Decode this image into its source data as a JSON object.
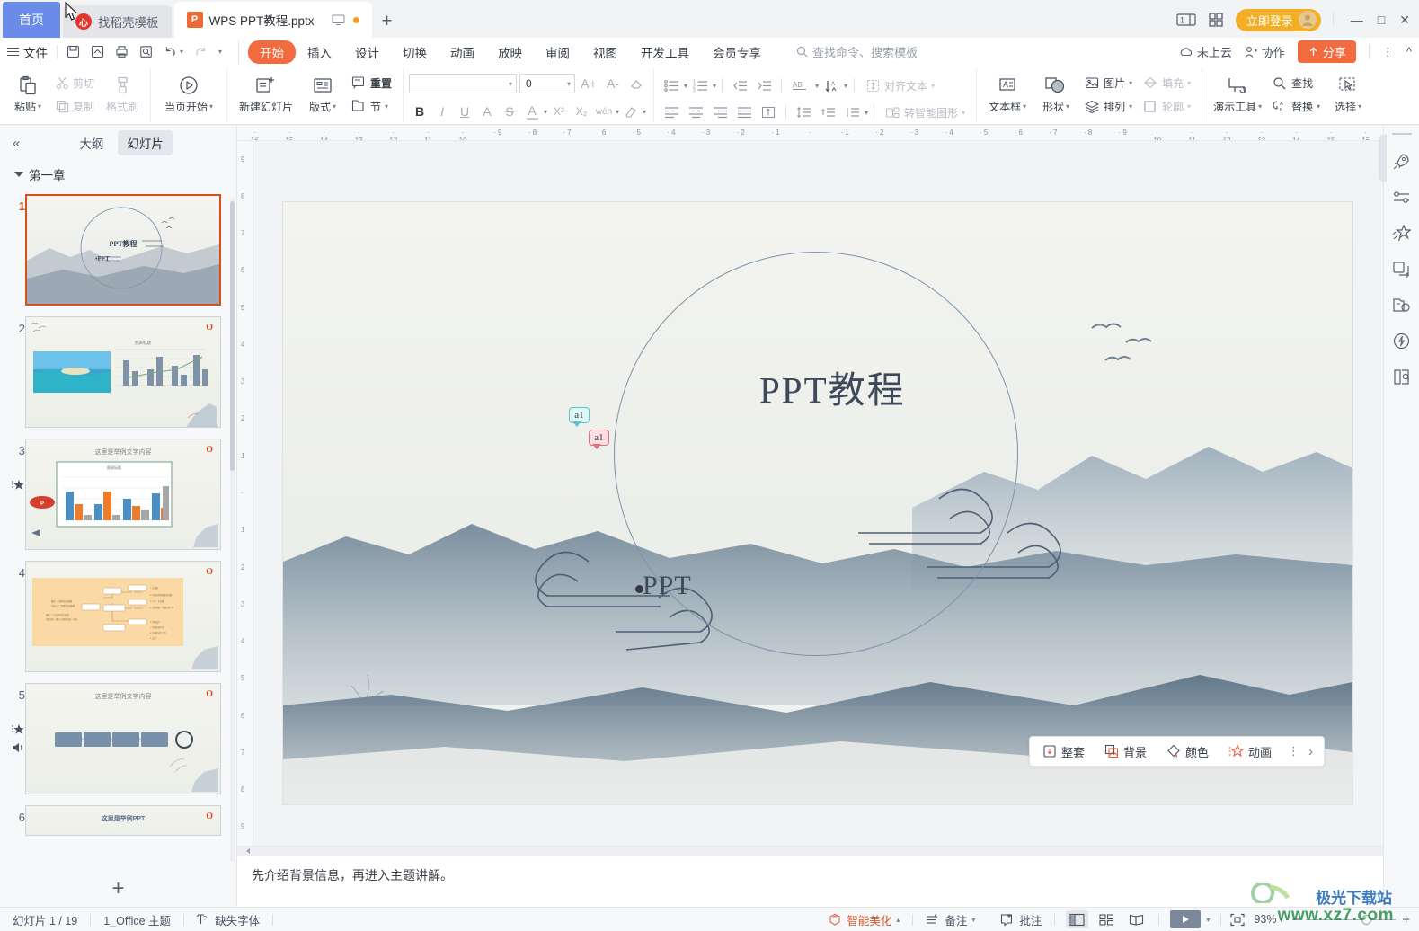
{
  "titlebar": {
    "home_tab": "首页",
    "tabs": [
      {
        "label": "找稻壳模板",
        "icon": "daoke-icon",
        "active": false
      },
      {
        "label": "WPS PPT教程.pptx",
        "icon": "wps-ppt-icon",
        "active": true
      }
    ],
    "new_tab": "+",
    "login_label": "立即登录",
    "minimize": "—",
    "maximize": "□",
    "close": "✕"
  },
  "menubar": {
    "file_label": "文件",
    "quick_access": [
      "save-icon",
      "save-as-icon",
      "print-icon",
      "print-preview-icon",
      "undo-icon",
      "redo-icon",
      "customize-icon"
    ],
    "tabs": [
      {
        "label": "开始",
        "selected": true
      },
      {
        "label": "插入",
        "selected": false
      },
      {
        "label": "设计",
        "selected": false
      },
      {
        "label": "切换",
        "selected": false
      },
      {
        "label": "动画",
        "selected": false
      },
      {
        "label": "放映",
        "selected": false
      },
      {
        "label": "审阅",
        "selected": false
      },
      {
        "label": "视图",
        "selected": false
      },
      {
        "label": "开发工具",
        "selected": false
      },
      {
        "label": "会员专享",
        "selected": false
      }
    ],
    "search_placeholder": "查找命令、搜索模板",
    "cloud_label": "未上云",
    "collab_label": "协作",
    "share_label": "分享",
    "more": "⋮"
  },
  "ribbon": {
    "clipboard": {
      "paste": "粘贴",
      "cut": "剪切",
      "copy": "复制",
      "format_painter": "格式刷"
    },
    "present": {
      "start_here": "当页开始"
    },
    "slides": {
      "new_slide": "新建幻灯片",
      "layout": "版式",
      "reset": "重置",
      "section": "节"
    },
    "font": {
      "family_value": "",
      "size_value": "0",
      "grow": "A+",
      "shrink": "A-",
      "clear_format": "clear-format-icon",
      "bold": "B",
      "italic": "I",
      "underline": "U",
      "char_border": "A",
      "strikethrough": "S",
      "font_color": "font-color-icon",
      "superscript": "X²",
      "subscript": "X₂",
      "phonetic": "phonetic-icon",
      "highlight": "highlight-icon"
    },
    "paragraph": {
      "bullets": "bullets-icon",
      "numbering": "numbering-icon",
      "decrease_indent": "decrease-indent-icon",
      "increase_indent": "increase-indent-icon",
      "text_direction": "text-direction-icon",
      "sort": "sort-icon",
      "align_text_label": "对齐文本",
      "align_left": "align-left-icon",
      "align_center": "align-center-icon",
      "align_right": "align-right-icon",
      "align_justify": "align-justify-icon",
      "align_distribute": "align-distribute-icon",
      "line_spacing": "line-spacing-icon",
      "para_spacing": "para-spacing-icon",
      "row_spacing": "row-spacing-icon",
      "smartart_label": "转智能图形"
    },
    "drawing": {
      "textbox": "文本框",
      "shape": "形状",
      "picture": "图片",
      "arrange": "排列",
      "fill": "填充",
      "outline": "轮廓"
    },
    "tools": {
      "present_tools": "演示工具",
      "find": "查找",
      "replace": "替换",
      "select": "选择"
    }
  },
  "leftpanel": {
    "collapse_icon": "collapse-panel-icon",
    "tabs": [
      {
        "label": "大纲",
        "selected": false
      },
      {
        "label": "幻灯片",
        "selected": true
      }
    ],
    "section_title": "第一章",
    "slides": [
      {
        "number": "1",
        "selected": true,
        "title": "PPT教程",
        "marks": []
      },
      {
        "number": "2",
        "selected": false,
        "title": "",
        "marks": []
      },
      {
        "number": "3",
        "selected": false,
        "title": "这里是举例文字内容",
        "marks": [
          "animation-icon"
        ]
      },
      {
        "number": "4",
        "selected": false,
        "title": "",
        "marks": []
      },
      {
        "number": "5",
        "selected": false,
        "title": "这里是举例文字内容",
        "marks": [
          "animation-icon",
          "audio-icon"
        ]
      },
      {
        "number": "6",
        "selected": false,
        "title": "这里是举例PPT",
        "marks": []
      }
    ],
    "add_slide": "+"
  },
  "ruler": {
    "h_ticks": [
      "16",
      "15",
      "14",
      "13",
      "12",
      "11",
      "10",
      "9",
      "8",
      "7",
      "6",
      "5",
      "4",
      "3",
      "2",
      "1",
      "",
      "1",
      "2",
      "3",
      "4",
      "5",
      "6",
      "7",
      "8",
      "9",
      "10",
      "11",
      "12",
      "13",
      "14",
      "15",
      "16"
    ],
    "v_ticks": [
      "9",
      "8",
      "7",
      "6",
      "5",
      "4",
      "3",
      "2",
      "1",
      "",
      "1",
      "2",
      "3",
      "4",
      "5",
      "6",
      "7",
      "8",
      "9"
    ]
  },
  "slide": {
    "title": "PPT教程",
    "subtitle": "PPT",
    "comments": [
      {
        "label": "a1",
        "color": "#5fc3cc"
      },
      {
        "label": "a1",
        "color": "#e0717c"
      }
    ]
  },
  "floatbar": {
    "items": [
      {
        "label": "整套",
        "icon": "whole-set-icon"
      },
      {
        "label": "背景",
        "icon": "background-icon"
      },
      {
        "label": "颜色",
        "icon": "color-icon"
      },
      {
        "label": "动画",
        "icon": "animation-icon"
      }
    ],
    "more": "⋮",
    "expand": "›"
  },
  "notes": {
    "text": "先介绍背景信息，再进入主题讲解。"
  },
  "righttool": {
    "icons": [
      "rocket-icon",
      "slider-icon",
      "animation-star-icon",
      "duplicate-icon",
      "image-tools-icon",
      "lightning-icon",
      "doc-search-icon"
    ]
  },
  "status": {
    "slide_count": "幻灯片 1 / 19",
    "theme": "1_Office 主题",
    "missing_font": "缺失字体",
    "beautify": "智能美化",
    "notes_label": "备注",
    "comment_label": "批注",
    "views": [
      "normal-view-icon",
      "slide-sorter-icon",
      "reading-view-icon"
    ],
    "play": "play-icon",
    "fit_icon": "fit-to-window-icon",
    "zoom": "93%",
    "zoom_out": "−",
    "zoom_in": "+"
  },
  "watermark": {
    "line1": "极光下载站",
    "line2": "www.xz7.com"
  },
  "colors": {
    "accent_orange": "#f26b3f",
    "accent_blue": "#6a8be8",
    "accent_gold": "#f2ae24",
    "selected_slide_border": "#d4501e"
  }
}
